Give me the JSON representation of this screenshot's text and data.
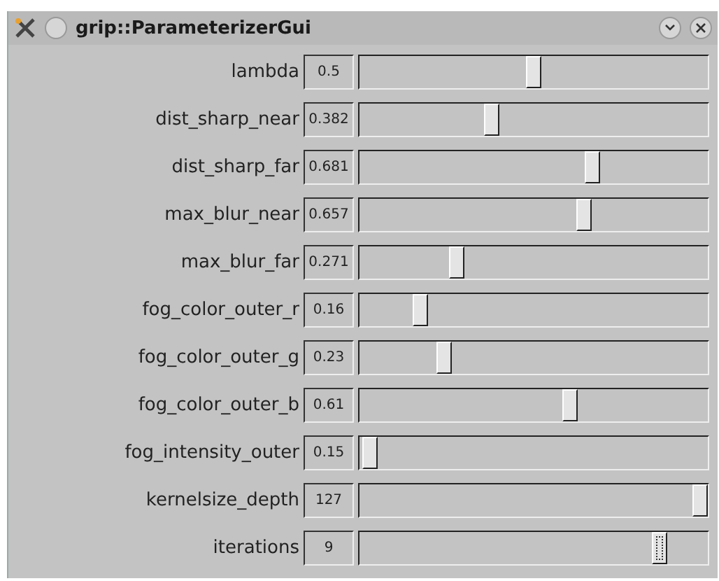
{
  "window": {
    "title": "grip::ParameterizerGui"
  },
  "parameters": [
    {
      "name": "lambda",
      "value": "0.5",
      "level": 0.5,
      "focused": false
    },
    {
      "name": "dist_sharp_near",
      "value": "0.382",
      "level": 0.375,
      "focused": false
    },
    {
      "name": "dist_sharp_far",
      "value": "0.681",
      "level": 0.675,
      "focused": false
    },
    {
      "name": "max_blur_near",
      "value": "0.657",
      "level": 0.65,
      "focused": false
    },
    {
      "name": "max_blur_far",
      "value": "0.271",
      "level": 0.27,
      "focused": false
    },
    {
      "name": "fog_color_outer_r",
      "value": "0.16",
      "level": 0.16,
      "focused": false
    },
    {
      "name": "fog_color_outer_g",
      "value": "0.23",
      "level": 0.23,
      "focused": false
    },
    {
      "name": "fog_color_outer_b",
      "value": "0.61",
      "level": 0.61,
      "focused": false
    },
    {
      "name": "fog_intensity_outer",
      "value": "0.15",
      "level": 0.01,
      "focused": false
    },
    {
      "name": "kernelsize_depth",
      "value": "127",
      "level": 1,
      "focused": false
    },
    {
      "name": "iterations",
      "value": "9",
      "level": 0.88,
      "focused": true
    }
  ]
}
